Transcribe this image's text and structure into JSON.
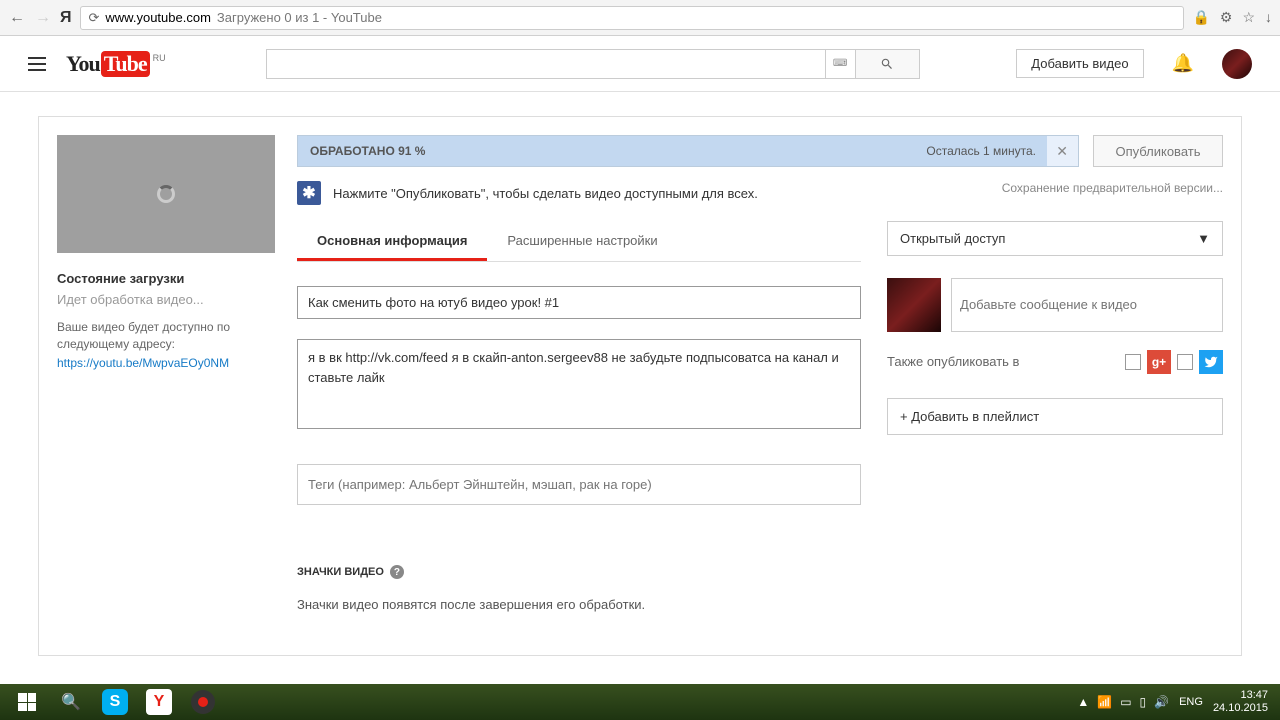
{
  "browser": {
    "url": "www.youtube.com",
    "title": "Загружено 0 из 1 - YouTube"
  },
  "header": {
    "region": "RU",
    "upload_btn": "Добавить видео"
  },
  "sidebar": {
    "status_title": "Состояние загрузки",
    "status_text": "Идет обработка видео...",
    "status_desc": "Ваше видео будет доступно по следующему адресу:",
    "video_link": "https://youtu.be/MwpvaEOy0NM"
  },
  "progress": {
    "label": "ОБРАБОТАНО 91 %",
    "eta": "Осталась 1 минута."
  },
  "buttons": {
    "publish": "Опубликовать",
    "playlist": "+ Добавить в плейлист"
  },
  "save_note": "Сохранение предварительной версии...",
  "hint": "Нажмите \"Опубликовать\", чтобы сделать видео доступными для всех.",
  "tabs": {
    "basic": "Основная информация",
    "advanced": "Расширенные настройки"
  },
  "fields": {
    "title": "Как сменить фото на ютуб видео урок! #1",
    "description": "я в вк http://vk.com/feed я в скайп-anton.sergeev88 не забудьте подпысоватса на канал и ставьте лайк",
    "tags_placeholder": "Теги (например: Альберт Эйнштейн, мэшап, рак на горе)"
  },
  "thumbs": {
    "title": "ЗНАЧКИ ВИДЕО",
    "desc": "Значки видео появятся после завершения его обработки."
  },
  "privacy": {
    "selected": "Открытый доступ"
  },
  "share": {
    "msg_placeholder": "Добавьте сообщение к видео",
    "also_label": "Также опубликовать в"
  },
  "taskbar": {
    "lang": "ENG",
    "time": "13:47",
    "date": "24.10.2015"
  }
}
